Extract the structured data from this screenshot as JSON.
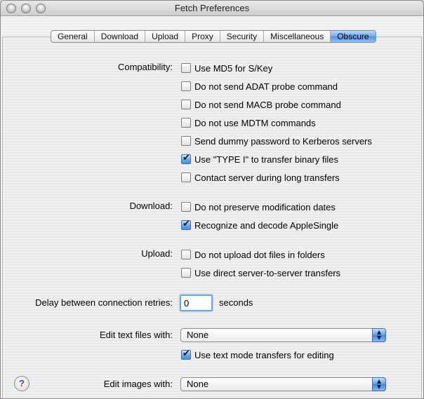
{
  "window": {
    "title": "Fetch Preferences"
  },
  "tabs": [
    {
      "label": "General",
      "active": false
    },
    {
      "label": "Download",
      "active": false
    },
    {
      "label": "Upload",
      "active": false
    },
    {
      "label": "Proxy",
      "active": false
    },
    {
      "label": "Security",
      "active": false
    },
    {
      "label": "Miscellaneous",
      "active": false
    },
    {
      "label": "Obscure",
      "active": true
    }
  ],
  "compatibility": {
    "label": "Compatibility:",
    "options": [
      {
        "label": "Use MD5 for S/Key",
        "checked": false
      },
      {
        "label": "Do not send ADAT probe command",
        "checked": false
      },
      {
        "label": "Do not send MACB probe command",
        "checked": false
      },
      {
        "label": "Do not use MDTM commands",
        "checked": false
      },
      {
        "label": "Send dummy password to Kerberos servers",
        "checked": false
      },
      {
        "label": "Use \"TYPE I\" to transfer binary files",
        "checked": true
      },
      {
        "label": "Contact server during long transfers",
        "checked": false
      }
    ]
  },
  "download": {
    "label": "Download:",
    "options": [
      {
        "label": "Do not preserve modification dates",
        "checked": false
      },
      {
        "label": "Recognize and decode AppleSingle",
        "checked": true
      }
    ]
  },
  "upload": {
    "label": "Upload:",
    "options": [
      {
        "label": "Do not upload dot files in folders",
        "checked": false
      },
      {
        "label": "Use direct server-to-server transfers",
        "checked": false
      }
    ]
  },
  "delay": {
    "label": "Delay between connection retries:",
    "value": "0",
    "unit": "seconds"
  },
  "edit_text": {
    "label": "Edit text files with:",
    "selected": "None",
    "option": {
      "label": "Use text mode transfers for editing",
      "checked": true
    }
  },
  "edit_images": {
    "label": "Edit images with:",
    "selected": "None"
  },
  "help": {
    "glyph": "?"
  },
  "icons": {
    "checkmark": "checkmark-icon",
    "popup_arrows": "updown-arrows-icon",
    "help": "help-icon"
  },
  "colors": {
    "accent": "#5e9be6",
    "focus_ring": "#6aa3ea"
  }
}
